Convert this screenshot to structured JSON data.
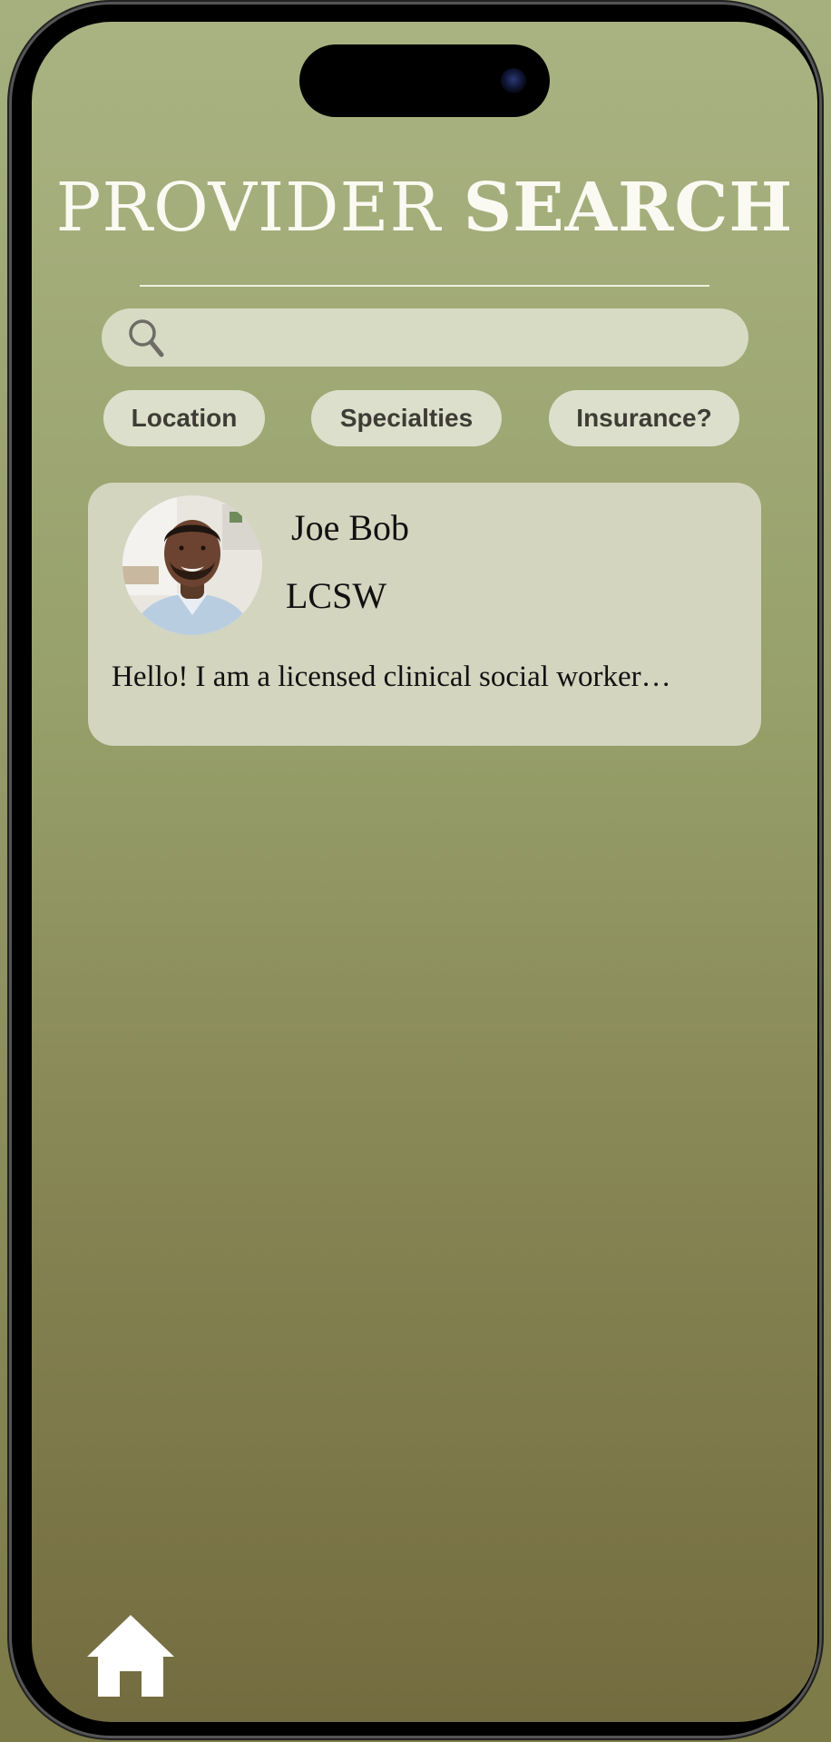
{
  "header": {
    "title_light": "PROVIDER",
    "title_bold": "SEARCH"
  },
  "search": {
    "value": "",
    "placeholder": ""
  },
  "filters": [
    {
      "label": "Location"
    },
    {
      "label": "Specialties"
    },
    {
      "label": "Insurance?"
    }
  ],
  "providers": [
    {
      "name": "Joe Bob",
      "credential": "LCSW",
      "bio": "Hello! I am a licensed clinical social worker…"
    }
  ],
  "icons": {
    "search": "search-icon",
    "home": "home-icon",
    "avatar": "avatar-photo"
  },
  "colors": {
    "accent_light": "#a9b382",
    "accent_dark": "#736c40",
    "card": "#d3d5bf",
    "chip": "#dcdfcb",
    "title": "#fafaf2"
  }
}
